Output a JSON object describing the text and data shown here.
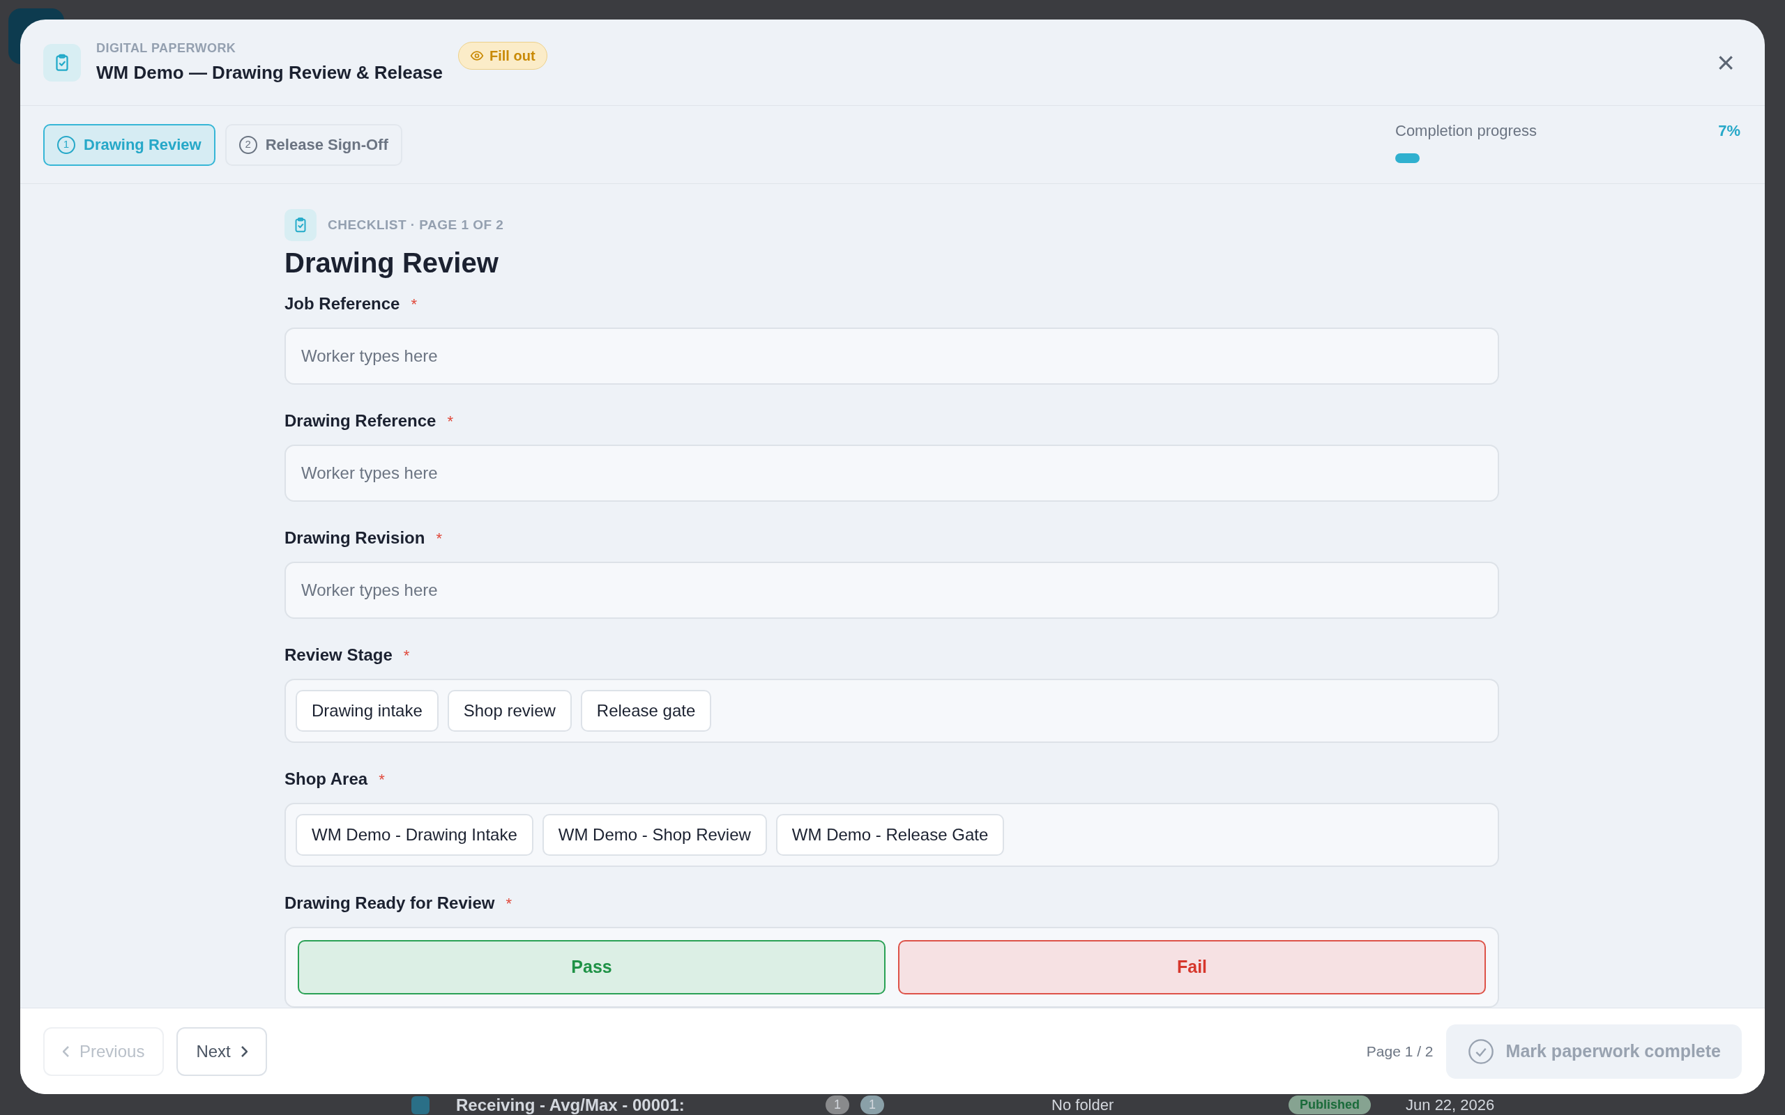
{
  "background_row": {
    "title": "Receiving - Avg/Max - 00001:",
    "count_1": "1",
    "count_2": "1",
    "folder": "No folder",
    "status": "Published",
    "date": "Jun 22, 2026"
  },
  "dialog": {
    "eyebrow": "DIGITAL PAPERWORK",
    "title": "WM Demo — Drawing Review & Release",
    "mode_badge": "Fill out",
    "close": "×"
  },
  "steps": [
    {
      "number": "1",
      "label": "Drawing Review",
      "selected": true
    },
    {
      "number": "2",
      "label": "Release Sign-Off",
      "selected": false
    }
  ],
  "progress": {
    "label": "Completion progress",
    "reading": "7%",
    "level": 0.07
  },
  "page": {
    "eyebrow": "CHECKLIST · PAGE 1 OF 2",
    "title": "Drawing Review"
  },
  "fields": [
    {
      "kind": "text",
      "label": "Job Reference",
      "required_mark": "*",
      "placeholder": "Worker types here"
    },
    {
      "kind": "text",
      "label": "Drawing Reference",
      "required_mark": "*",
      "placeholder": "Worker types here"
    },
    {
      "kind": "text",
      "label": "Drawing Revision",
      "required_mark": "*",
      "placeholder": "Worker types here"
    },
    {
      "kind": "choice",
      "label": "Review Stage",
      "required_mark": "*",
      "options": [
        {
          "label": "Drawing intake",
          "selected": false
        },
        {
          "label": "Shop review",
          "selected": false
        },
        {
          "label": "Release gate",
          "selected": false
        }
      ]
    },
    {
      "kind": "choice",
      "label": "Shop Area",
      "required_mark": "*",
      "options": [
        {
          "label": "WM Demo - Drawing Intake",
          "selected": false
        },
        {
          "label": "WM Demo - Shop Review",
          "selected": false
        },
        {
          "label": "WM Demo - Release Gate",
          "selected": false
        }
      ]
    },
    {
      "kind": "passfail",
      "label": "Drawing Ready for Review",
      "required_mark": "*",
      "pass": "Pass",
      "fail": "Fail"
    }
  ],
  "footer": {
    "previous": "Previous",
    "previous_disabled": true,
    "next": "Next",
    "page_indicator": "Page 1 / 2",
    "complete": "Mark paperwork complete",
    "complete_disabled": true
  }
}
